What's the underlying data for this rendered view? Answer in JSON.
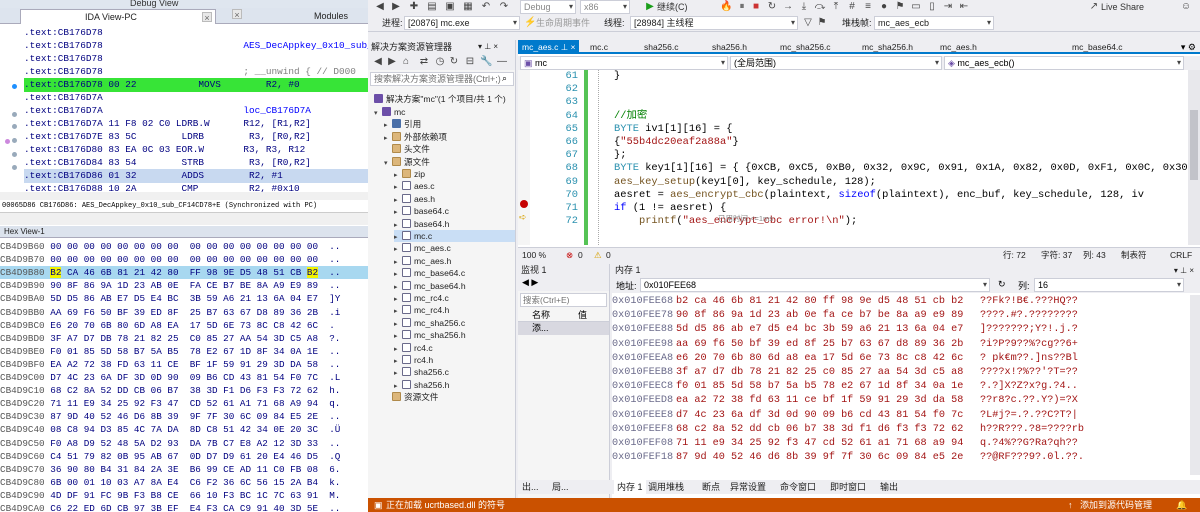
{
  "ida": {
    "top_tabs": [
      "Debug View",
      "Modules"
    ],
    "tab_title": "IDA View-PC",
    "code_lines": [
      {
        "seg": ".text:CB176D78",
        "rest": "",
        "style": ""
      },
      {
        "seg": ".text:CB176D78",
        "rest": "                         AES_DecAppkey_0x10_sub_CF14CD78",
        "style": "lbl"
      },
      {
        "seg": ".text:CB176D78",
        "rest": "",
        "style": ""
      },
      {
        "seg": ".text:CB176D78",
        "rest": "                         ; __unwind { // D000",
        "style": "cmt"
      },
      {
        "seg": ".text:CB176D78",
        "rest": " 00 22           MOVS        R2, #0",
        "style": "green"
      },
      {
        "seg": ".text:CB176D7A",
        "rest": "",
        "style": ""
      },
      {
        "seg": ".text:CB176D7A",
        "rest": "                         loc_CB176D7A",
        "style": "lbl"
      },
      {
        "seg": ".text:CB176D7A",
        "rest": " 11 F8 02 C0 LDRB.W      R12, [R1,R2]",
        "style": ""
      },
      {
        "seg": ".text:CB176D7E",
        "rest": " 83 5C        LDRB        R3, [R0,R2]",
        "style": ""
      },
      {
        "seg": ".text:CB176D80",
        "rest": " 83 EA 0C 03 EOR.W       R3, R3, R12",
        "style": ""
      },
      {
        "seg": ".text:CB176D84",
        "rest": " 83 54        STRB        R3, [R0,R2]",
        "style": ""
      },
      {
        "seg": ".text:CB176D86",
        "rest": " 01 32        ADDS        R2, #1",
        "style": "blue"
      },
      {
        "seg": ".text:CB176D88",
        "rest": " 10 2A        CMP         R2, #0x10",
        "style": ""
      }
    ],
    "status_text": "00065D86 CB176D86: AES_DecAppkey_0x10_sub_CF14CD78+E (Synchronized with PC)",
    "hex_title": "Hex View-1",
    "hex_rows": [
      {
        "addr": "CB4D9B60",
        "bytes": "00 00 00 00 00 00 00 00  00 00 00 00 00 00 00 00",
        "ascii": "..",
        "hl": false
      },
      {
        "addr": "CB4D9B70",
        "bytes": "00 00 00 00 00 00 00 00  00 00 00 00 00 00 00 00",
        "ascii": "..",
        "hl": false
      },
      {
        "addr": "CB4D9B80",
        "bytes": "B2 CA 46 6B 81 21 42 80  FF 98 9E D5 48 51 CB B2",
        "ascii": "..",
        "hl": true
      },
      {
        "addr": "CB4D9B90",
        "bytes": "90 8F 86 9A 1D 23 AB 0E  FA CE B7 BE 8A A9 E9 89",
        "ascii": "..",
        "hl": false
      },
      {
        "addr": "CB4D9BA0",
        "bytes": "5D D5 86 AB E7 D5 E4 BC  3B 59 A6 21 13 6A 04 E7",
        "ascii": "]Y",
        "hl": false
      },
      {
        "addr": "CB4D9BB0",
        "bytes": "AA 69 F6 50 BF 39 ED 8F  25 B7 63 67 D8 89 36 2B",
        "ascii": ".i",
        "hl": false
      },
      {
        "addr": "CB4D9BC0",
        "bytes": "E6 20 70 6B 80 6D A8 EA  17 5D 6E 73 8C C8 42 6C",
        "ascii": ". ",
        "hl": false
      },
      {
        "addr": "CB4D9BD0",
        "bytes": "3F A7 D7 DB 78 21 82 25  C0 85 27 AA 54 3D C5 A8",
        "ascii": "?.",
        "hl": false
      },
      {
        "addr": "CB4D9BE0",
        "bytes": "F0 01 85 5D 58 B7 5A B5  78 E2 67 1D 8F 34 0A 1E",
        "ascii": "..",
        "hl": false
      },
      {
        "addr": "CB4D9BF0",
        "bytes": "EA A2 72 38 FD 63 11 CE  BF 1F 59 91 29 3D DA 58",
        "ascii": "..",
        "hl": false
      },
      {
        "addr": "CB4D9C00",
        "bytes": "D7 4C 23 6A DF 3D 0D 90  09 B6 CD 43 81 54 F0 7C",
        "ascii": ".L",
        "hl": false
      },
      {
        "addr": "CB4D9C10",
        "bytes": "68 C2 8A 52 DD CB 06 B7  38 3D F1 D6 F3 F3 72 62",
        "ascii": "h.",
        "hl": false
      },
      {
        "addr": "CB4D9C20",
        "bytes": "71 11 E9 34 25 92 F3 47  CD 52 61 A1 71 68 A9 94",
        "ascii": "q.",
        "hl": false
      },
      {
        "addr": "CB4D9C30",
        "bytes": "87 9D 40 52 46 D6 8B 39  9F 7F 30 6C 09 84 E5 2E",
        "ascii": "..",
        "hl": false
      },
      {
        "addr": "CB4D9C40",
        "bytes": "08 C8 94 D3 85 4C 7A DA  8D C8 51 42 34 0E 20 3C",
        "ascii": ".Ü",
        "hl": false
      },
      {
        "addr": "CB4D9C50",
        "bytes": "F0 A8 D9 52 48 5A D2 93  DA 7B C7 E8 A2 12 3D 33",
        "ascii": "..",
        "hl": false
      },
      {
        "addr": "CB4D9C60",
        "bytes": "C4 51 79 82 0B 95 AB 67  0D D7 D9 61 20 E4 46 D5",
        "ascii": ".Q",
        "hl": false
      },
      {
        "addr": "CB4D9C70",
        "bytes": "36 90 80 B4 31 84 2A 3E  B6 99 CE AD 11 C0 FB 08",
        "ascii": "6.",
        "hl": false
      },
      {
        "addr": "CB4D9C80",
        "bytes": "6B 00 01 10 03 A7 8A E4  C6 F2 36 6C 56 15 2A B4",
        "ascii": "k.",
        "hl": false
      },
      {
        "addr": "CB4D9C90",
        "bytes": "4D DF 91 FC 9B F3 B8 CE  66 10 F3 BC 1C 7C 63 91",
        "ascii": "M.",
        "hl": false
      },
      {
        "addr": "CB4D9CA0",
        "bytes": "C6 22 ED 6D CB 97 3B EF  E4 F3 CA C9 91 40 3D 5E",
        "ascii": "..",
        "hl": false
      }
    ]
  },
  "vs": {
    "toolbar": {
      "config": "Debug",
      "platform": "x86",
      "continue_label": "继续(C)",
      "live_share": "Live Share",
      "process_label": "进程:",
      "process_value": "[20876] mc.exe",
      "lifecycle_label": "生命周期事件",
      "thread_label": "线程:",
      "thread_value": "[28984] 主线程",
      "stack_label": "堆栈帧:",
      "stack_value": "mc_aes_ecb"
    },
    "solution": {
      "title": "解决方案资源管理器",
      "search_placeholder": "搜索解决方案资源管理器(Ctrl+;)",
      "root": "解决方案\"mc\"(1 个项目/共 1 个)",
      "items": [
        {
          "label": "mc",
          "depth": 1,
          "icon": "proj",
          "arrow": "▾"
        },
        {
          "label": "引用",
          "depth": 2,
          "icon": "ref",
          "arrow": "▸"
        },
        {
          "label": "外部依赖项",
          "depth": 2,
          "icon": "folder",
          "arrow": "▸"
        },
        {
          "label": "头文件",
          "depth": 2,
          "icon": "folder",
          "arrow": ""
        },
        {
          "label": "源文件",
          "depth": 2,
          "icon": "folder",
          "arrow": "▾"
        },
        {
          "label": "zip",
          "depth": 3,
          "icon": "folder",
          "arrow": "▸"
        },
        {
          "label": "aes.c",
          "depth": 3,
          "icon": "c",
          "arrow": "▸"
        },
        {
          "label": "aes.h",
          "depth": 3,
          "icon": "h",
          "arrow": "▸"
        },
        {
          "label": "base64.c",
          "depth": 3,
          "icon": "c",
          "arrow": "▸"
        },
        {
          "label": "base64.h",
          "depth": 3,
          "icon": "h",
          "arrow": "▸"
        },
        {
          "label": "mc.c",
          "depth": 3,
          "icon": "c",
          "arrow": "▸"
        },
        {
          "label": "mc_aes.c",
          "depth": 3,
          "icon": "c",
          "arrow": "▸"
        },
        {
          "label": "mc_aes.h",
          "depth": 3,
          "icon": "h",
          "arrow": "▸"
        },
        {
          "label": "mc_base64.c",
          "depth": 3,
          "icon": "c",
          "arrow": "▸"
        },
        {
          "label": "mc_base64.h",
          "depth": 3,
          "icon": "h",
          "arrow": "▸"
        },
        {
          "label": "mc_rc4.c",
          "depth": 3,
          "icon": "c",
          "arrow": "▸"
        },
        {
          "label": "mc_rc4.h",
          "depth": 3,
          "icon": "h",
          "arrow": "▸"
        },
        {
          "label": "mc_sha256.c",
          "depth": 3,
          "icon": "c",
          "arrow": "▸"
        },
        {
          "label": "mc_sha256.h",
          "depth": 3,
          "icon": "h",
          "arrow": "▸"
        },
        {
          "label": "rc4.c",
          "depth": 3,
          "icon": "c",
          "arrow": "▸"
        },
        {
          "label": "rc4.h",
          "depth": 3,
          "icon": "h",
          "arrow": "▸"
        },
        {
          "label": "sha256.c",
          "depth": 3,
          "icon": "c",
          "arrow": "▸"
        },
        {
          "label": "sha256.h",
          "depth": 3,
          "icon": "h",
          "arrow": "▸"
        },
        {
          "label": "资源文件",
          "depth": 2,
          "icon": "folder",
          "arrow": ""
        }
      ]
    },
    "editor": {
      "tabs": [
        "mc_aes.c",
        "mc.c",
        "sha256.c",
        "sha256.h",
        "mc_sha256.c",
        "mc_sha256.h",
        "mc_aes.h",
        "mc_base64.c"
      ],
      "nav_file": "mc",
      "nav_scope": "(全局范围)",
      "nav_func": "mc_aes_ecb()",
      "lines": [
        {
          "num": "61",
          "html": "<span class='nm'>}</span>"
        },
        {
          "num": "62",
          "html": ""
        },
        {
          "num": "63",
          "html": ""
        },
        {
          "num": "64",
          "html": "<span class='cm'>//加密</span>"
        },
        {
          "num": "65",
          "html": "<span class='ty'>BYTE</span> iv1[1][16] = {"
        },
        {
          "num": "66",
          "html": "{<span class='str'>\"55b4dc20eaf2a88a\"</span>}"
        },
        {
          "num": "67",
          "html": "};"
        },
        {
          "num": "68",
          "html": "<span class='ty'>BYTE</span> key1[1][16] = { {0xCB, 0xC5, 0xB0, 0x32, 0x9C, 0x91, 0x1A, 0x82, 0x0D, 0xF1, 0x0C, 0x30, 0xC"
        },
        {
          "num": "69",
          "html": "<span class='fn'>aes_key_setup</span>(key1[0], key_schedule, 128);"
        },
        {
          "num": "70",
          "html": "aesret = <span class='fn'>aes_encrypt_cbc</span>(plaintext, <span class='kw'>sizeof</span>(plaintext), enc_buf, key_schedule, 128, iv"
        },
        {
          "num": "71",
          "html": "<span class='kw'>if</span> (1 != aesret) {"
        },
        {
          "num": "72",
          "html": "    <span class='fn'>printf</span>(<span class='str'>\"aes_encrypt_cbc error!\\n\"</span>);"
        }
      ],
      "elapsed_hint": "已用时间 <=1ms",
      "zoom": "100 %",
      "errors": "0",
      "warnings": "0",
      "line_info": "行: 72",
      "char_info": "字符: 37",
      "col_info": "列: 43",
      "tabs_mode": "制表符",
      "eol": "CRLF"
    },
    "watch": {
      "title": "监视 1",
      "search_placeholder": "搜索(Ctrl+E)",
      "col_name": "名称",
      "col_value": "值",
      "add_hint": "添..."
    },
    "memory": {
      "title": "内存 1",
      "addr_label": "地址:",
      "addr_value": "0x010FEE68",
      "cols_label": "列:",
      "cols_value": "16",
      "rows": [
        {
          "a": "0x010FEE68",
          "b": "b2 ca 46 6b 81 21 42 80 ff 98 9e d5 48 51 cb b2",
          "c": "??Fk?!B€.???HQ??"
        },
        {
          "a": "0x010FEE78",
          "b": "90 8f 86 9a 1d 23 ab 0e fa ce b7 be 8a a9 e9 89",
          "c": "????.#?.????????"
        },
        {
          "a": "0x010FEE88",
          "b": "5d d5 86 ab e7 d5 e4 bc 3b 59 a6 21 13 6a 04 e7",
          "c": "]???????;Y?!.j.?"
        },
        {
          "a": "0x010FEE98",
          "b": "aa 69 f6 50 bf 39 ed 8f 25 b7 63 67 d8 89 36 2b",
          "c": "?i?P?9??%?cg??6+"
        },
        {
          "a": "0x010FEEA8",
          "b": "e6 20 70 6b 80 6d a8 ea 17 5d 6e 73 8c c8 42 6c",
          "c": "? pk€m??.]ns??Bl"
        },
        {
          "a": "0x010FEEB8",
          "b": "3f a7 d7 db 78 21 82 25 c0 85 27 aa 54 3d c5 a8",
          "c": "????x!?%??'?T=??"
        },
        {
          "a": "0x010FEEC8",
          "b": "f0 01 85 5d 58 b7 5a b5 78 e2 67 1d 8f 34 0a 1e",
          "c": "?.?]X?Z?x?g.?4.."
        },
        {
          "a": "0x010FEED8",
          "b": "ea a2 72 38 fd 63 11 ce bf 1f 59 91 29 3d da 58",
          "c": "??r8?c.??.Y?)=?X"
        },
        {
          "a": "0x010FEEE8",
          "b": "d7 4c 23 6a df 3d 0d 90 09 b6 cd 43 81 54 f0 7c",
          "c": "?L#j?=.?.??C?T?|"
        },
        {
          "a": "0x010FEEF8",
          "b": "68 c2 8a 52 dd cb 06 b7 38 3d f1 d6 f3 f3 72 62",
          "c": "h??R???.?8=????rb"
        },
        {
          "a": "0x010FEF08",
          "b": "71 11 e9 34 25 92 f3 47 cd 52 61 a1 71 68 a9 94",
          "c": "q.?4%??G?Ra?qh??"
        },
        {
          "a": "0x010FEF18",
          "b": "87 9d 40 52 46 d6 8b 39 9f 7f 30 6c 09 84 e5 2e",
          "c": "??@RF???9?.0l.??."
        }
      ]
    },
    "bottom_tabs": [
      "内存 1",
      "调用堆栈",
      "断点",
      "异常设置",
      "命令窗口",
      "即时窗口",
      "输出"
    ],
    "left_bottom_tabs": [
      "出...",
      "局..."
    ],
    "status_left": "正在加载 ucrtbased.dll 的符号",
    "status_right": "添加到源代码管理"
  }
}
